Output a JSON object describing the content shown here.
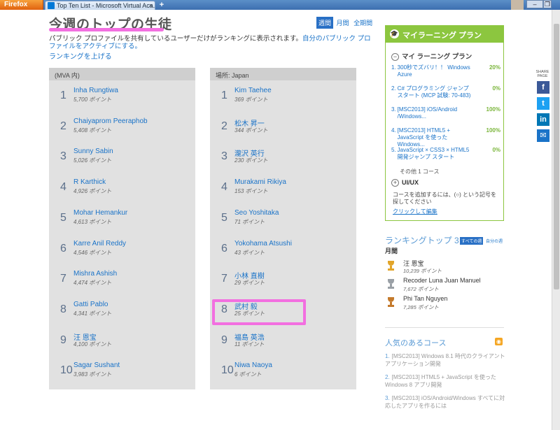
{
  "browser": {
    "menu_button": "Firefox",
    "tab_title": "Top Ten List - Microsoft Virtual Aca...",
    "tab_close": "×",
    "new_tab": "+",
    "minimize": "–",
    "restore": "❐",
    "close": "✕"
  },
  "header": {
    "title": "今週のトップの生徒",
    "period_tabs": [
      "週間",
      "月間",
      "全期間"
    ],
    "description": "パブリック プロファイルを共有しているユーザーだけがランキングに表示されます。",
    "description_link": "自分のパブリック プロファイルをアクティブにする。",
    "rank_up_link": "ランキングを上げる"
  },
  "board_mva": {
    "heading": "(MVA 内)",
    "rows": [
      {
        "rank": "1",
        "name": "Inha Rungtiwa",
        "points": "5,700 ポイント"
      },
      {
        "rank": "2",
        "name": "Chaiyaprom Peeraphob",
        "points": "5,408 ポイント"
      },
      {
        "rank": "3",
        "name": "Sunny Sabin",
        "points": "5,026 ポイント"
      },
      {
        "rank": "4",
        "name": "R Karthick",
        "points": "4,926 ポイント"
      },
      {
        "rank": "5",
        "name": "Mohar Hemankur",
        "points": "4,613 ポイント"
      },
      {
        "rank": "6",
        "name": "Karre Anil Reddy",
        "points": "4,546 ポイント"
      },
      {
        "rank": "7",
        "name": "Mishra Ashish",
        "points": "4,474 ポイント"
      },
      {
        "rank": "8",
        "name": "Gatti Pablo",
        "points": "4,341 ポイント"
      },
      {
        "rank": "9",
        "name": "汪 恩宝",
        "points": "4,100 ポイント"
      },
      {
        "rank": "10",
        "name": "Sagar Sushant",
        "points": "3,983 ポイント"
      }
    ]
  },
  "board_japan": {
    "heading": "場所: Japan",
    "rows": [
      {
        "rank": "1",
        "name": "Kim Taehee",
        "points": "369 ポイント"
      },
      {
        "rank": "2",
        "name": "松木 昇一",
        "points": "344 ポイント"
      },
      {
        "rank": "3",
        "name": "瀧沢 英行",
        "points": "230 ポイント"
      },
      {
        "rank": "4",
        "name": "Murakami Rikiya",
        "points": "153 ポイント"
      },
      {
        "rank": "5",
        "name": "Seo Yoshitaka",
        "points": "71 ポイント"
      },
      {
        "rank": "6",
        "name": "Yokohama Atsushi",
        "points": "43 ポイント"
      },
      {
        "rank": "7",
        "name": "小林 直樹",
        "points": "29 ポイント"
      },
      {
        "rank": "8",
        "name": "武村 毅",
        "points": "25 ポイント"
      },
      {
        "rank": "9",
        "name": "福島 英浩",
        "points": "11 ポイント"
      },
      {
        "rank": "10",
        "name": "Niwa Naoya",
        "points": "6 ポイント"
      }
    ]
  },
  "learning_plan": {
    "title": "マイラーニング プラン",
    "subheading": "マイ ラーニング プラン",
    "items": [
      {
        "num": "1.",
        "text": "300秒でズバリ！！ Windows Azure",
        "pct": "20%"
      },
      {
        "num": "2.",
        "text": "C# プログラミング ジャンプ スタート (MCP 試験: 70-483)",
        "pct": "0%"
      },
      {
        "num": "3.",
        "text": "[MSC2013] iOS/Android /Windows...",
        "pct": "100%"
      },
      {
        "num": "4.",
        "text": "[MSC2013] HTML5 + JavaScript を使った Windows...",
        "pct": "100%"
      },
      {
        "num": "5.",
        "text": "JavaScript × CSS3 × HTML5 開発ジャンプ スタート",
        "pct": "0%"
      }
    ],
    "other": "その他 1 コース",
    "uiux": "UI/UX",
    "note": "コースを追加するには、(○) という記号を探してください",
    "edit_link": "クリックして編集"
  },
  "top3": {
    "title": "ランキングトップ 3",
    "buttons": [
      "すべての週",
      "自分の週"
    ],
    "period": "月間",
    "rows": [
      {
        "name": "汪 恩宝",
        "points": "10,239 ポイント",
        "medal": "gold"
      },
      {
        "name": "Recoder Luna Juan Manuel",
        "points": "7,672 ポイント",
        "medal": "silver"
      },
      {
        "name": "Phi Tan Nguyen",
        "points": "7,285 ポイント",
        "medal": "bronze"
      }
    ]
  },
  "popular": {
    "title": "人気のあるコース",
    "items": [
      {
        "num": "1.",
        "text": "[MSC2013] Windows 8.1 時代のクライアント アプリケーション開発"
      },
      {
        "num": "2.",
        "text": "[MSC2013] HTML5 + JavaScript を使った Windows 8 アプリ開発"
      },
      {
        "num": "3.",
        "text": "[MSC2013] iOS/Android/Windows すべてに対応したアプリを作るには"
      }
    ]
  },
  "share": {
    "label": "SHARE PAGE",
    "buttons": [
      {
        "glyph": "f",
        "color": "#3b5998"
      },
      {
        "glyph": "t",
        "color": "#1da1f2"
      },
      {
        "glyph": "in",
        "color": "#0077b5"
      },
      {
        "glyph": "✉",
        "color": "#1a73c8"
      }
    ]
  },
  "colors": {
    "accent": "#1a73c8",
    "plan_green": "#8cc63f",
    "highlight": "#f26fe0",
    "gold": "#e2a52a",
    "silver": "#9aa0a6",
    "bronze": "#c47a2c"
  }
}
